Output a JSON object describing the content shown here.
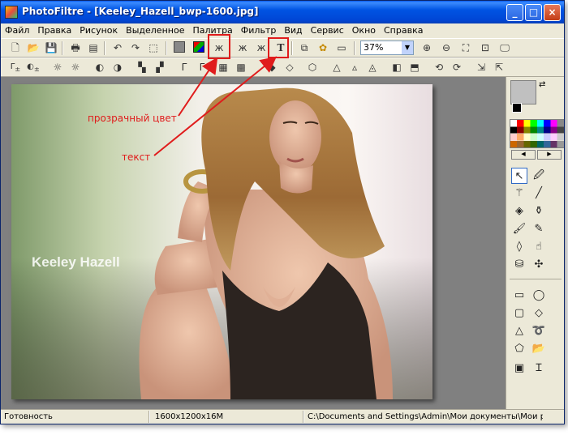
{
  "window": {
    "title": "PhotoFiltre - [Keeley_Hazell_bwp-1600.jpg]"
  },
  "menu": [
    "Файл",
    "Правка",
    "Рисунок",
    "Выделенное",
    "Палитра",
    "Фильтр",
    "Вид",
    "Сервис",
    "Окно",
    "Справка"
  ],
  "toolbar": {
    "zoom_value": "37%"
  },
  "statusbar": {
    "status": "Готовность",
    "size": "1600x1200x16M",
    "path": "C:\\Documents and Settings\\Admin\\Мои документы\\Мои рисунки\\"
  },
  "image": {
    "watermark": "Keeley Hazell"
  },
  "annotations": {
    "transparent_color": "прозрачный цвет",
    "text_tool": "текст"
  },
  "colors": {
    "titlebar": "#0054e3",
    "annotation": "#e01c1c",
    "workspace": "#808080",
    "chrome": "#ece9d8"
  },
  "icons": {
    "tb1": [
      "new-icon",
      "open-icon",
      "save-icon",
      "print-icon",
      "scan-icon",
      "undo-icon",
      "redo-icon",
      "crop-icon",
      "grayscale-icon",
      "rgb-icon",
      "transparent-color-icon",
      "transparent-gradient-icon",
      "frame-icon",
      "text-icon",
      "layers-icon",
      "plugins-icon",
      "window-icon",
      "zoom-in-icon",
      "zoom-out-icon",
      "fit-icon",
      "fullscreen-icon"
    ],
    "panel": [
      "select-arrow-icon",
      "eyedropper-icon",
      "magic-wand-icon",
      "line-icon",
      "fill-icon",
      "spray-icon",
      "brush-icon",
      "pencil-icon",
      "blur-drop-icon",
      "smudge-icon",
      "stamp-icon",
      "pattern-icon",
      "rectangle-icon",
      "ellipse-icon",
      "rounded-rect-icon",
      "diamond-icon",
      "triangle-icon",
      "lasso-icon",
      "polygon-icon",
      "open-folder-icon",
      "selection-icon",
      "text-selection-icon"
    ]
  }
}
